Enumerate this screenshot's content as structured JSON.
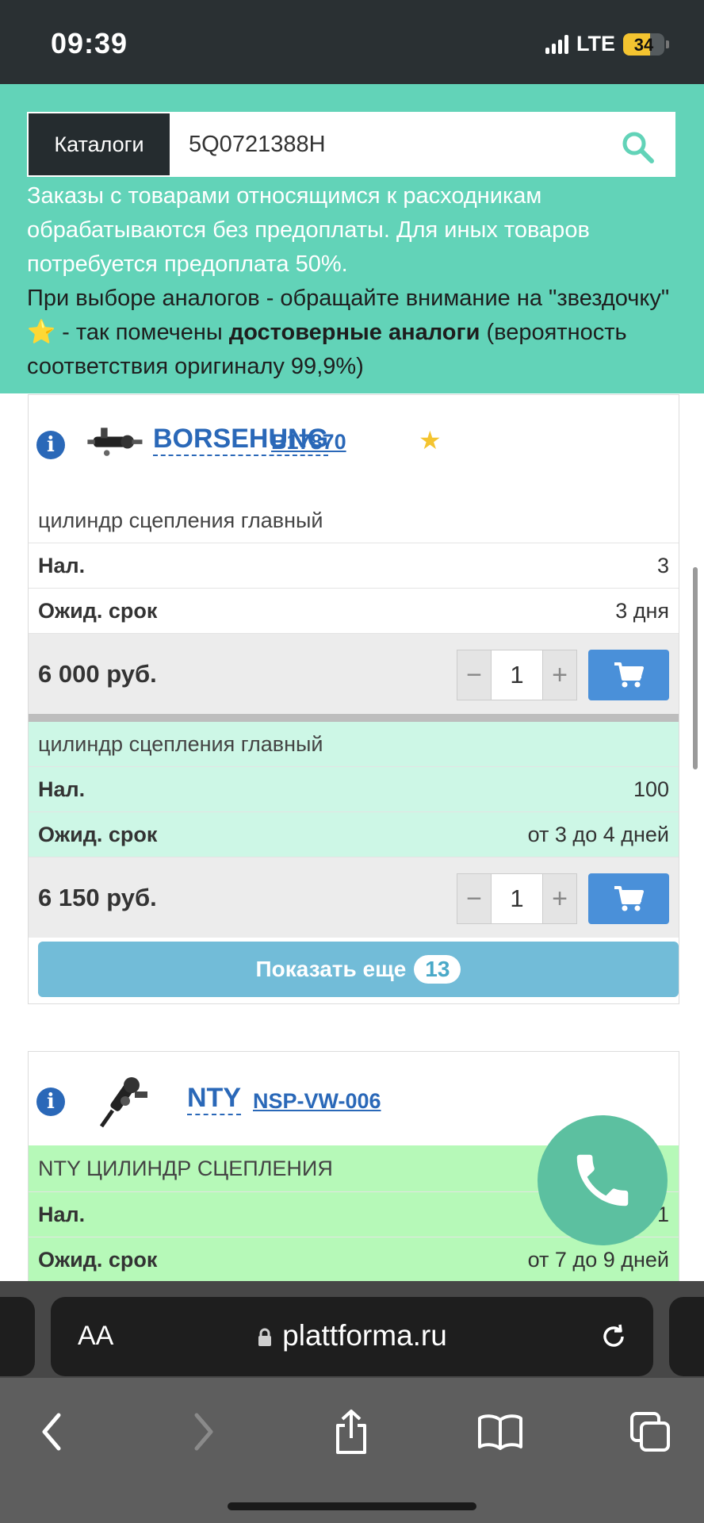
{
  "status_bar": {
    "time": "09:39",
    "network": "LTE",
    "battery": "34"
  },
  "header": {
    "catalog_button": "Каталоги",
    "search_value": "5Q0721388H",
    "notice_line1": "Заказы с товарами относящимся к расходникам обрабатываются без предоплаты. Для иных товаров потребуется предоплата 50%.",
    "notice_line2_a": "При выборе аналогов - обращайте внимание на \"звездочку\"",
    "notice_line2_b": " - так помечены ",
    "notice_bold": "достоверные аналоги",
    "notice_line2_c": " (вероятность соответствия оригиналу 99,9%)"
  },
  "products": [
    {
      "brand": "BORSEHUNG",
      "code": "B17870",
      "offers": [
        {
          "description": "цилиндр сцепления главный",
          "stock_label": "Нал.",
          "stock": "3",
          "term_label": "Ожид. срок",
          "term": "3 дня",
          "price": "6 000 руб.",
          "qty": "1"
        },
        {
          "description": "цилиндр сцепления главный",
          "stock_label": "Нал.",
          "stock": "100",
          "term_label": "Ожид. срок",
          "term": "от 3 до 4 дней",
          "price": "6 150 руб.",
          "qty": "1"
        }
      ],
      "show_more_label": "Показать еще",
      "show_more_count": "13"
    },
    {
      "brand": "NTY",
      "code": "NSP-VW-006",
      "offers": [
        {
          "description": "NTY ЦИЛИНДР СЦЕПЛЕНИЯ",
          "stock_label": "Нал.",
          "stock": "1",
          "term_label": "Ожид. срок",
          "term": "от 7 до 9 дней"
        }
      ]
    }
  ],
  "browser": {
    "aa_label": "AA",
    "url": "plattforma.ru"
  },
  "colors": {
    "accent": "#62d3b8",
    "link": "#2a68b8",
    "cart": "#4a90d9",
    "show_more": "#72bcd8"
  }
}
